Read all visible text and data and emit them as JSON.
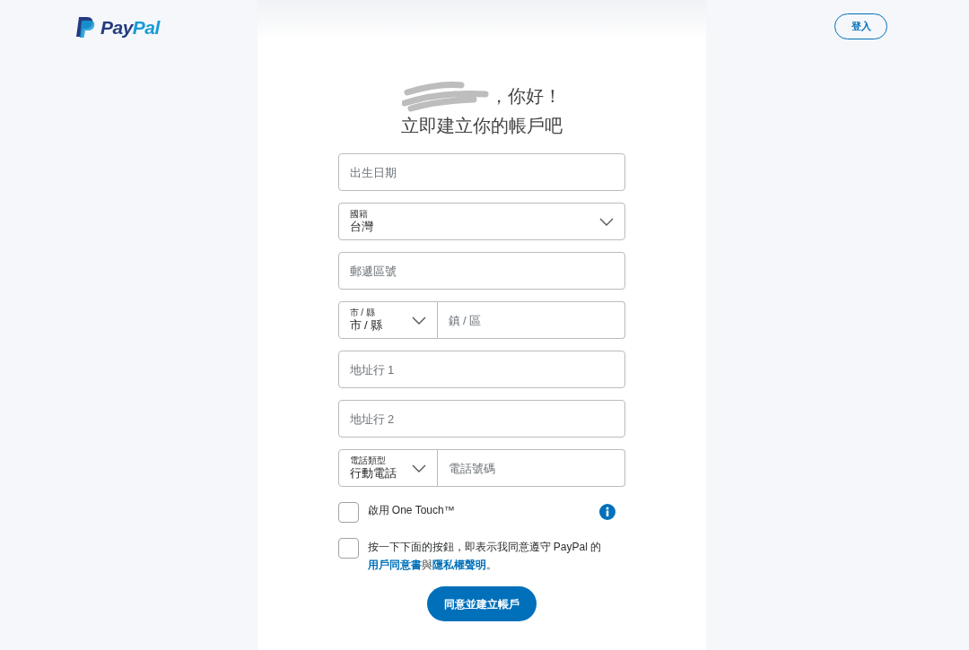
{
  "header": {
    "logo": {
      "first": "Pay",
      "second": "Pal"
    },
    "login_button": "登入"
  },
  "greeting": {
    "line1": "，你好！",
    "line2": "立即建立你的帳戶吧"
  },
  "fields": [
    {
      "kind": "text",
      "placeholder": "出生日期"
    },
    {
      "kind": "select",
      "label": "國籍",
      "value": "台灣"
    },
    {
      "kind": "text",
      "placeholder": "郵遞區號"
    },
    {
      "kind": "pair",
      "select": {
        "label": "市 / 縣",
        "value": "市 / 縣"
      },
      "input": {
        "placeholder": "鎮 / 區"
      }
    },
    {
      "kind": "text",
      "placeholder": "地址行 1"
    },
    {
      "kind": "text",
      "placeholder": "地址行 2"
    },
    {
      "kind": "pair",
      "select": {
        "label": "電話類型",
        "value": "行動電話"
      },
      "input": {
        "placeholder": "電話號碼"
      }
    }
  ],
  "one_touch": {
    "label": "啟用 One Touch™",
    "checked": false
  },
  "agreement": {
    "checked": false,
    "parts": [
      {
        "kind": "text",
        "text": "按一下下面的按鈕，即表示我同意遵守 PayPal 的"
      },
      {
        "kind": "link",
        "text": "用戶同意書"
      },
      {
        "kind": "text",
        "text": "與"
      },
      {
        "kind": "link",
        "text": "隱私權聲明"
      },
      {
        "kind": "text",
        "text": "。"
      }
    ]
  },
  "submit": "同意並建立帳戶"
}
